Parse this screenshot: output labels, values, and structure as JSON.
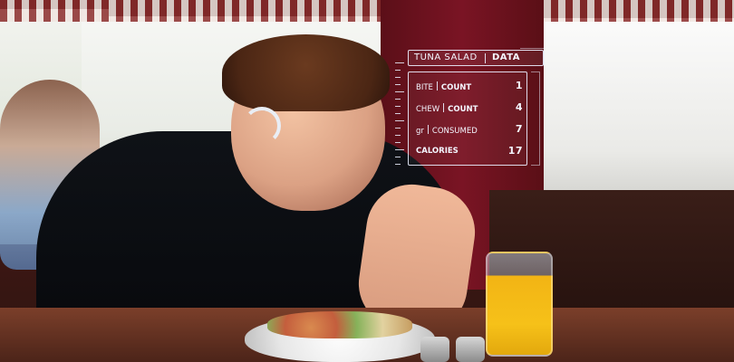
{
  "hud": {
    "title_left": "TUNA SALAD",
    "title_right": "DATA",
    "rows": [
      {
        "label_a": "BITE",
        "label_b": "COUNT",
        "value": "1"
      },
      {
        "label_a": "CHEW",
        "label_b": "COUNT",
        "value": "4"
      },
      {
        "label_a": "gr",
        "label_b": "CONSUMED",
        "value": "7"
      },
      {
        "label_a": "CALORIES",
        "label_b": "",
        "value": "17"
      }
    ]
  }
}
